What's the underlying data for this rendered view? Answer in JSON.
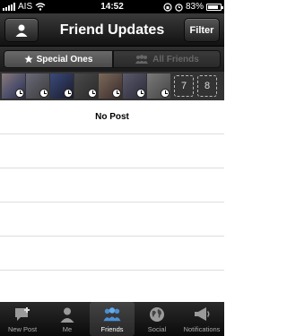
{
  "status_bar": {
    "carrier": "AIS",
    "time": "14:52",
    "battery": "83%"
  },
  "navbar": {
    "title": "Friend Updates",
    "filter_label": "Filter"
  },
  "segments": {
    "special": "Special Ones",
    "all": "All Friends"
  },
  "avatar_strip": {
    "counts": [
      "7",
      "8"
    ]
  },
  "list": {
    "empty_message": "No Post"
  },
  "tabs": [
    {
      "label": "New Post"
    },
    {
      "label": "Me"
    },
    {
      "label": "Friends"
    },
    {
      "label": "Social"
    },
    {
      "label": "Notifications"
    }
  ],
  "colors": {
    "active_tab_icon": "#4a8fd6"
  }
}
